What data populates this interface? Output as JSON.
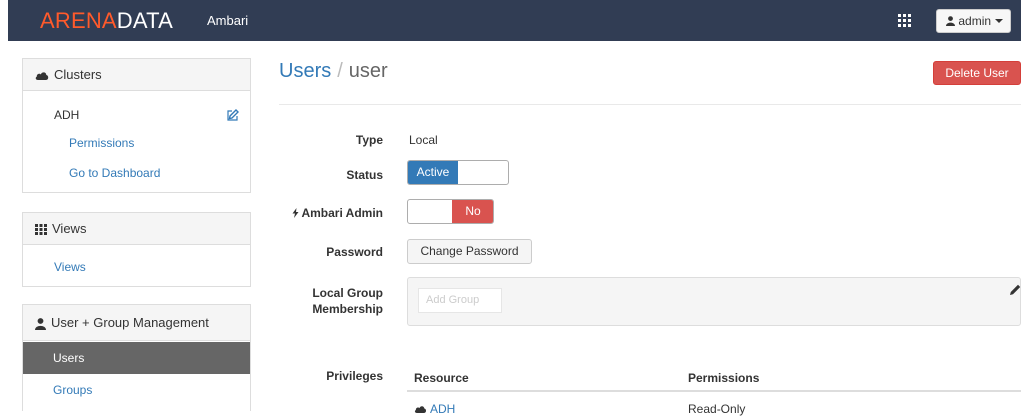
{
  "topbar": {
    "brand_part1": "ARENA",
    "brand_part2": "DATA",
    "app_name": "Ambari",
    "apps_icon": "grid-icon",
    "user_label": "admin",
    "user_icon": "user-icon"
  },
  "sidebar": {
    "clusters": {
      "header": "Clusters",
      "icon": "cloud-icon",
      "cluster_name": "ADH",
      "edit_icon": "edit-icon",
      "links": [
        "Permissions",
        "Go to Dashboard"
      ]
    },
    "views": {
      "header": "Views",
      "icon": "grid-list-icon",
      "links": [
        "Views"
      ]
    },
    "user_group": {
      "header": "User + Group Management",
      "icon": "user-icon",
      "items": [
        {
          "label": "Users",
          "active": true
        },
        {
          "label": "Groups",
          "active": false
        }
      ]
    }
  },
  "main": {
    "breadcrumb_root": "Users",
    "breadcrumb_separator": "/",
    "breadcrumb_current": "user",
    "delete_button": "Delete User",
    "fields": {
      "type_label": "Type",
      "type_value": "Local",
      "status_label": "Status",
      "status_value": "Active",
      "admin_label": "Ambari Admin",
      "admin_icon": "bolt-icon",
      "admin_value": "No",
      "password_label": "Password",
      "password_button": "Change Password",
      "group_label_line1": "Local Group",
      "group_label_line2": "Membership",
      "group_placeholder": "Add Group",
      "group_edit_icon": "pencil-icon",
      "privileges_label": "Privileges"
    },
    "privileges": {
      "columns": [
        "Resource",
        "Permissions"
      ],
      "rows": [
        {
          "resource": "ADH",
          "resource_icon": "cloud-icon",
          "permission": "Read-Only"
        }
      ]
    }
  },
  "colors": {
    "navbar": "#313d54",
    "brand_accent": "#ff5a2b",
    "link": "#337ab7",
    "danger": "#d9534f",
    "active_item": "#666666"
  }
}
